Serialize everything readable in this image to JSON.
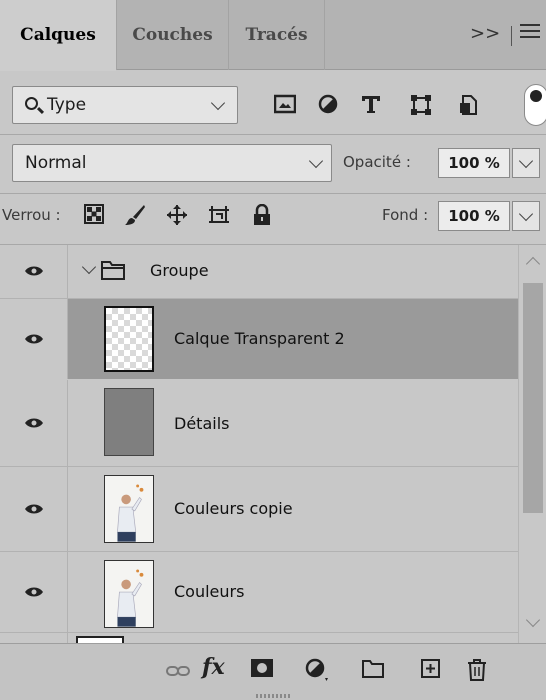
{
  "tabs": [
    {
      "label": "Calques",
      "active": true
    },
    {
      "label": "Couches",
      "active": false
    },
    {
      "label": "Tracés",
      "active": false
    }
  ],
  "tabs_overflow": ">>",
  "filter": {
    "icon": "search-icon",
    "label": "Type"
  },
  "filter_icons": [
    "image-filter-icon",
    "adjustment-filter-icon",
    "text-filter-icon",
    "shape-filter-icon",
    "smart-object-filter-icon"
  ],
  "blend": {
    "mode": "Normal",
    "opacity_label": "Opacité :",
    "opacity_value": "100 %"
  },
  "lock": {
    "label": "Verrou :",
    "fill_label": "Fond :",
    "fill_value": "100 %"
  },
  "lock_icons": [
    "lock-transparency-icon",
    "lock-pixels-icon",
    "lock-position-icon",
    "lock-artboard-icon",
    "lock-all-icon"
  ],
  "layers": [
    {
      "name": "Groupe",
      "type": "group",
      "visible": true,
      "expanded": true
    },
    {
      "name": "Calque Transparent 2",
      "type": "transparent",
      "visible": true,
      "selected": true
    },
    {
      "name": "Détails",
      "type": "gray",
      "visible": true
    },
    {
      "name": "Couleurs copie",
      "type": "photo",
      "visible": true
    },
    {
      "name": "Couleurs",
      "type": "photo",
      "visible": true
    }
  ],
  "bottom_icons": [
    "link-layers-icon",
    "fx-icon",
    "add-mask-icon",
    "adjustment-layer-icon",
    "new-group-icon",
    "new-layer-icon",
    "trash-icon"
  ],
  "bottom_fx_label": "fx",
  "colors": {
    "panel": "#c8c8c8",
    "selected_row": "#9a9a9a",
    "tab_bar": "#b3b3b3"
  }
}
